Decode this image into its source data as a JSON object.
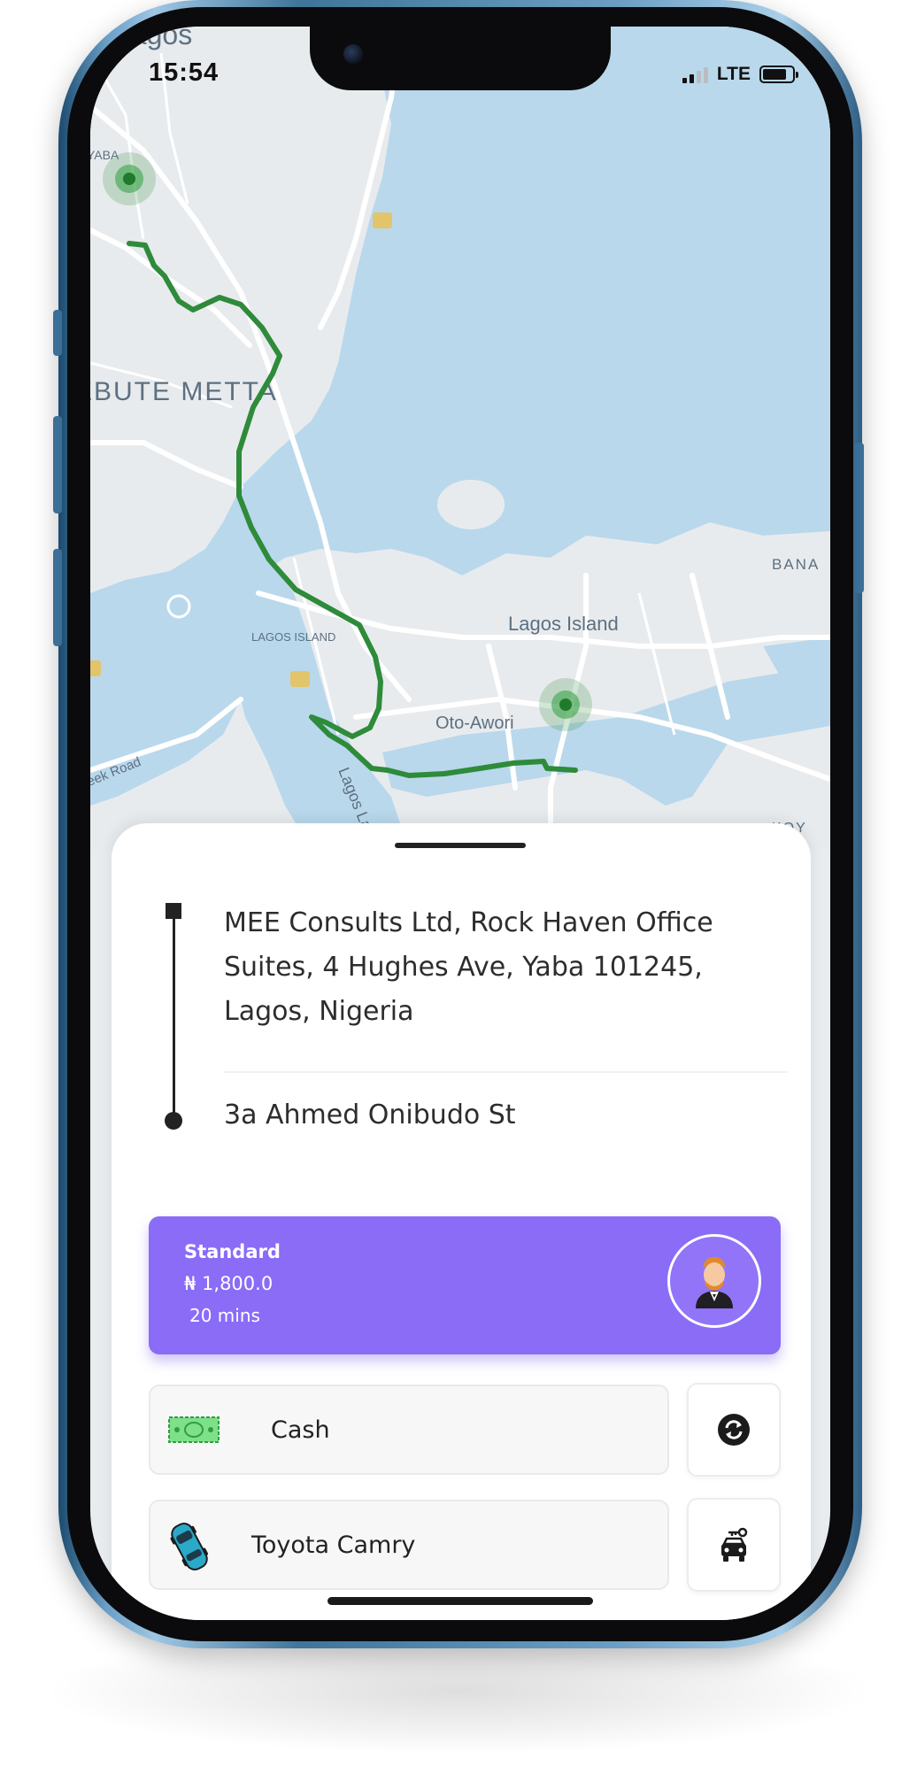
{
  "status_bar": {
    "time": "15:54",
    "network": "LTE",
    "signal_bars_filled": 2,
    "signal_bars_total": 4
  },
  "map": {
    "labels": {
      "city": "Lagos",
      "yaba": "YABA",
      "ebute_metta": "EBUTE METTA",
      "lagos_island_district": "LAGOS ISLAND",
      "lagos_island": "Lagos Island",
      "oto_awori": "Oto-Awori",
      "lagos_lagoon": "Lagos La",
      "creek_road": "reek Road",
      "banana": "BANA",
      "ikoyi": "KOY"
    },
    "route_color": "#2e8b3a",
    "water_color": "#b9d8ec",
    "land_color": "#e8ebee"
  },
  "trip": {
    "pickup_address": "MEE Consults Ltd, Rock Haven Office Suites, 4 Hughes Ave, Yaba 101245, Lagos, Nigeria",
    "dropoff_address": "3a Ahmed Onibudo St"
  },
  "ride_option": {
    "name": "Standard",
    "price": "₦ 1,800.0",
    "eta": "20 mins",
    "card_color": "#8a6cf7"
  },
  "payment": {
    "label": "Cash",
    "icon": "cash-icon",
    "swap_icon": "swap-icon"
  },
  "vehicle": {
    "label": "Toyota Camry",
    "icon": "car-icon",
    "action_icon": "car-key-icon"
  }
}
